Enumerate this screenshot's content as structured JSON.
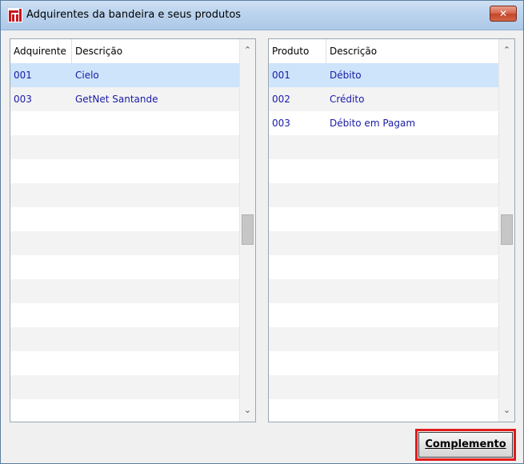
{
  "window": {
    "title": "Adquirentes da bandeira e seus produtos",
    "close_label": "✕"
  },
  "left_table": {
    "columns": [
      "Adquirente",
      "Descrição"
    ],
    "rows": [
      {
        "code": "001",
        "desc": "Cielo",
        "selected": true
      },
      {
        "code": "003",
        "desc": "GetNet Santande",
        "selected": false
      }
    ]
  },
  "right_table": {
    "columns": [
      "Produto",
      "Descrição"
    ],
    "rows": [
      {
        "code": "001",
        "desc": "Débito",
        "selected": true
      },
      {
        "code": "002",
        "desc": "Crédito",
        "selected": false
      },
      {
        "code": "003",
        "desc": "Débito em Pagam",
        "selected": false
      }
    ]
  },
  "buttons": {
    "complemento": "Complemento"
  },
  "icons": {
    "app": "app-logo-icon",
    "scroll_up": "chevron-up-icon",
    "scroll_down": "chevron-down-icon"
  },
  "colors": {
    "selected_row": "#cde4fb",
    "text": "#1a1aa8",
    "highlight": "#e11b1b"
  }
}
